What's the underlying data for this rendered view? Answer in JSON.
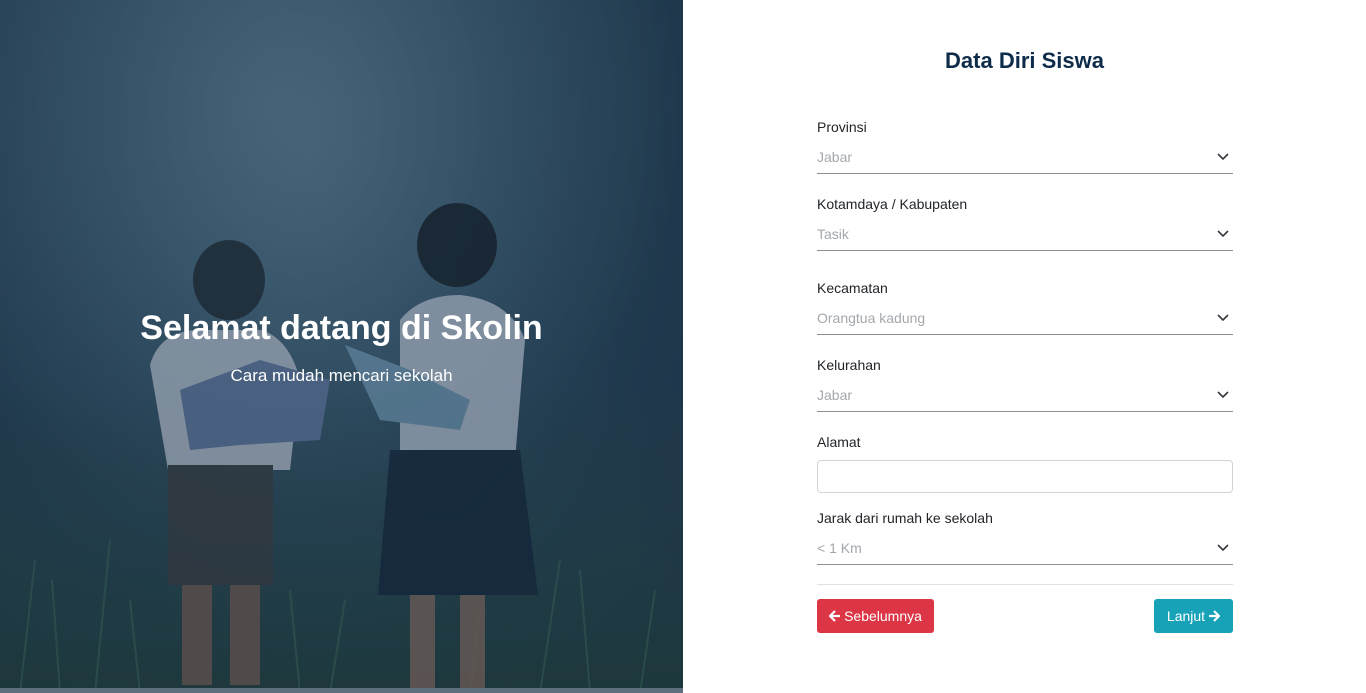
{
  "hero": {
    "title": "Selamat datang di Skolin",
    "subtitle": "Cara mudah mencari sekolah"
  },
  "form": {
    "title": "Data Diri Siswa",
    "fields": {
      "provinsi": {
        "label": "Provinsi",
        "value": "Jabar"
      },
      "kota": {
        "label": "Kotamdaya / Kabupaten",
        "value": "Tasik"
      },
      "kecamatan": {
        "label": "Kecamatan",
        "value": "Orangtua kadung"
      },
      "kelurahan": {
        "label": "Kelurahan",
        "value": "Jabar"
      },
      "alamat": {
        "label": "Alamat",
        "value": ""
      },
      "jarak": {
        "label": "Jarak dari rumah ke sekolah",
        "value": "< 1 Km"
      }
    },
    "buttons": {
      "prev_label": "Sebelumnya",
      "next_label": "Lanjut"
    }
  },
  "colors": {
    "title": "#0d2b4a",
    "prev_button": "#dc3545",
    "next_button": "#17a2b8"
  },
  "icons": {
    "select_caret": "chevron-down-icon",
    "prev": "arrow-left-icon",
    "next": "arrow-right-icon"
  }
}
